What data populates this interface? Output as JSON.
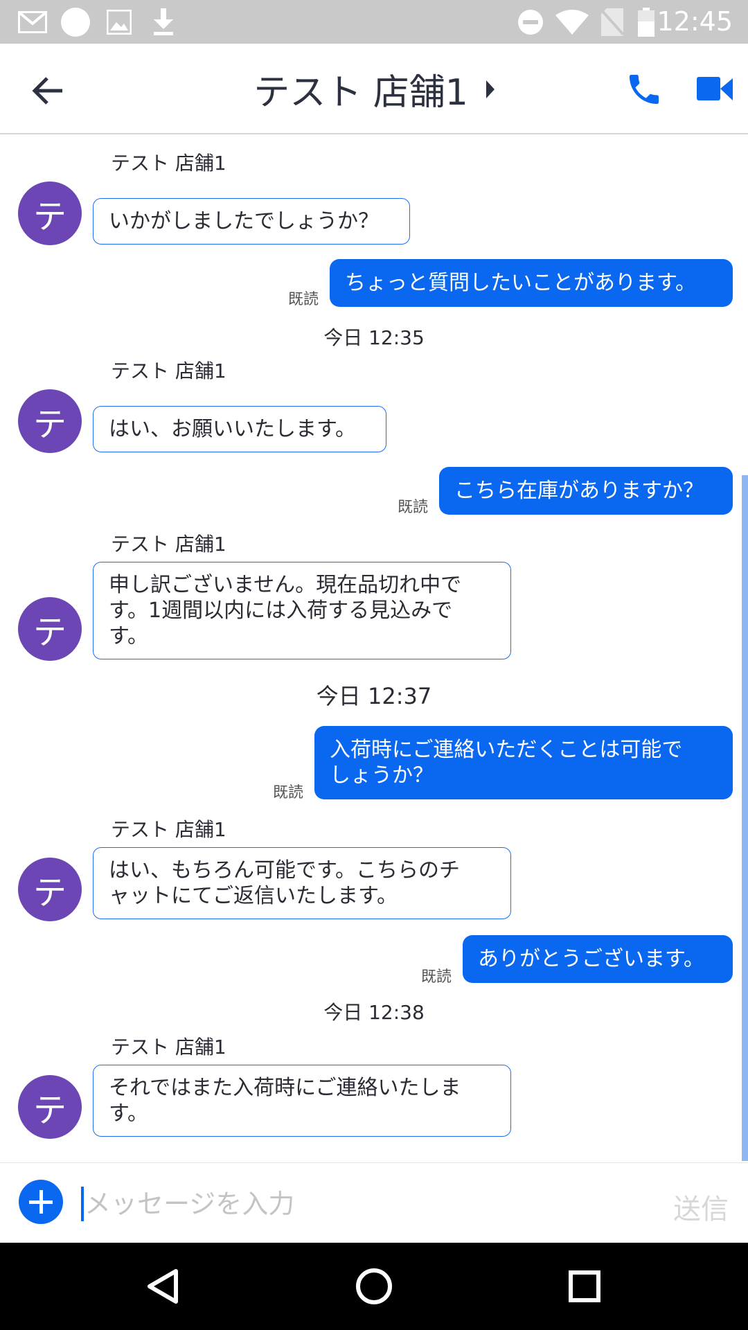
{
  "status_bar": {
    "time": "12:45",
    "icons": [
      "gmail-icon",
      "circle-icon",
      "image-icon",
      "download-icon",
      "dnd-icon",
      "wifi-icon",
      "no-sim-icon",
      "battery-icon"
    ]
  },
  "header": {
    "title": "テスト 店舗1",
    "icons": [
      "back-arrow-icon",
      "caret-right-icon",
      "phone-icon",
      "video-camera-icon"
    ]
  },
  "avatar_initial": "テ",
  "read_label": "既読",
  "messages": {
    "m1": {
      "sender": "テスト 店舗1",
      "text": "いかがしましたでしょうか？"
    },
    "m2": {
      "text": "ちょっと質問したいことがあります。"
    },
    "t1": "今日 12:35",
    "m3": {
      "sender": "テスト 店舗1",
      "text": "はい、お願いいたします。"
    },
    "m4": {
      "text": "こちら在庫がありますか？"
    },
    "m5": {
      "sender": "テスト 店舗1",
      "line1": "申し訳ございません。現在品切れ中で",
      "line2": "す。1週間以内には入荷する見込みで",
      "line3": "す。"
    },
    "t2": "今日 12:37",
    "m6": {
      "line1": "入荷時にご連絡いただくことは可能で",
      "line2": "しょうか？"
    },
    "m7": {
      "sender": "テスト 店舗1",
      "line1": "はい、もちろん可能です。こちらのチ",
      "line2": "ャットにてご返信いたします。"
    },
    "m8": {
      "text": "ありがとうございます。"
    },
    "t3": "今日 12:38",
    "m9": {
      "sender": "テスト 店舗1",
      "line1": "それではまた入荷時にご連絡いたしま",
      "line2": "す。"
    }
  },
  "input": {
    "placeholder": "メッセージを入力",
    "value": "",
    "send_label": "送信"
  },
  "nav_bar": {
    "icons": [
      "back-triangle-icon",
      "home-circle-icon",
      "recents-square-icon"
    ]
  },
  "colors": {
    "accent": "#0a68f0",
    "avatar": "#6b46b4",
    "status_bar": "#c9c9c9"
  }
}
